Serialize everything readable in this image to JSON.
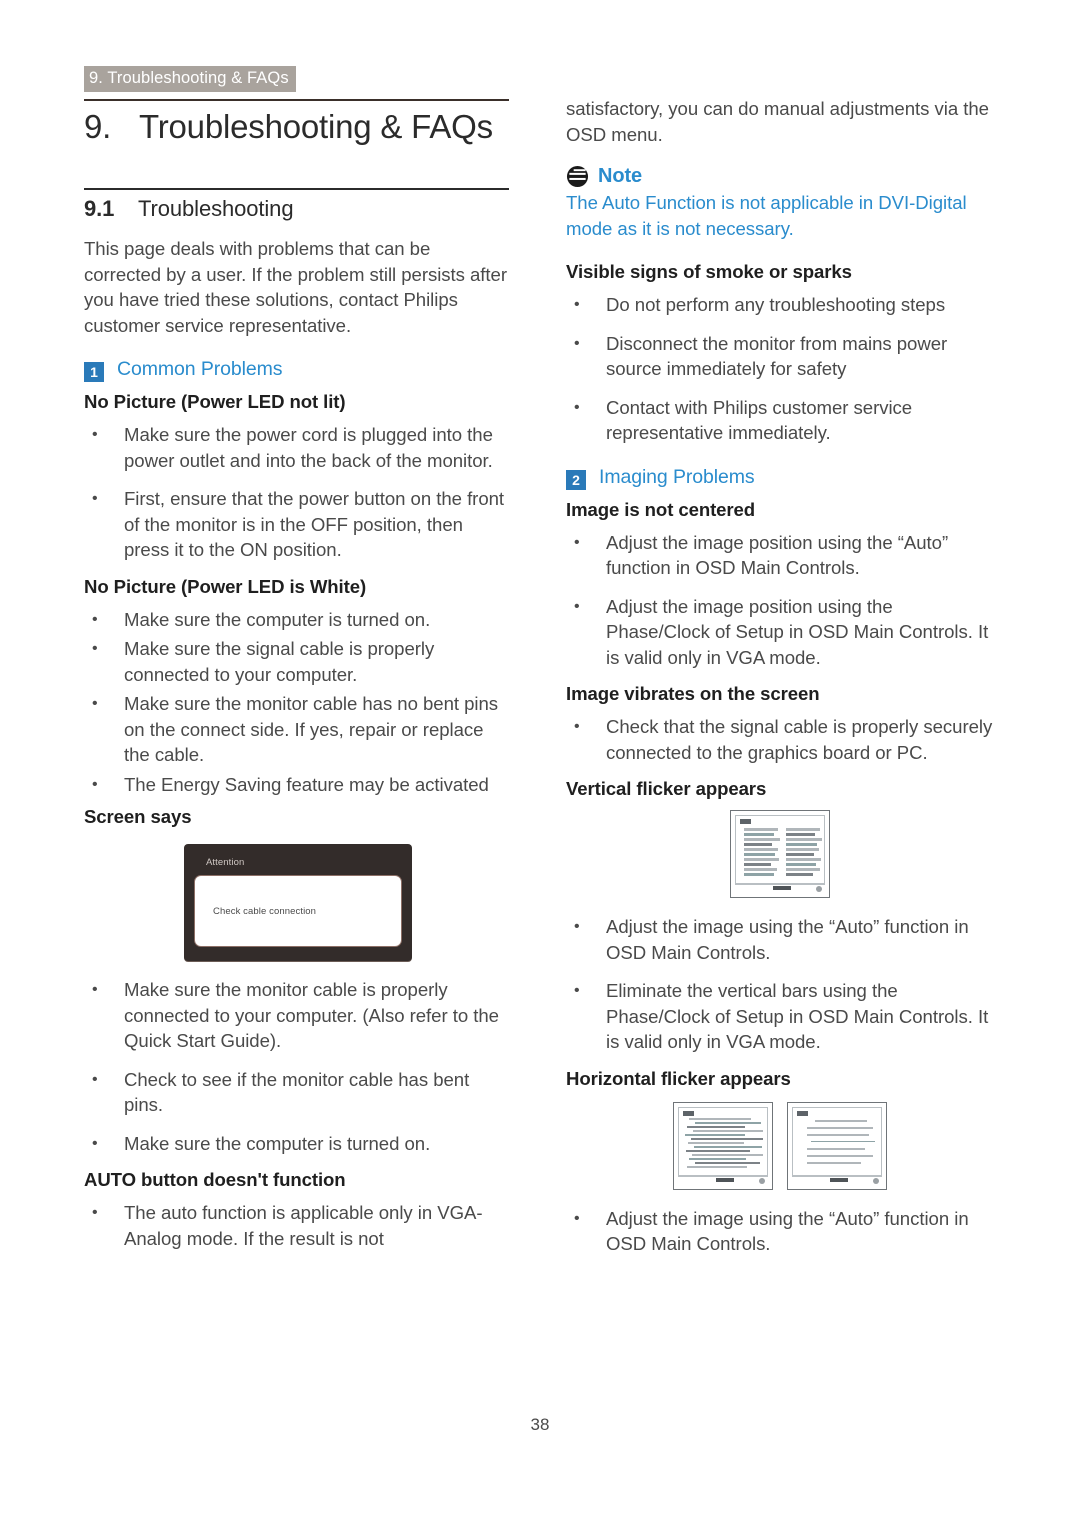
{
  "header": {
    "breadcrumb": "9. Troubleshooting & FAQs",
    "chapter_number": "9.",
    "chapter_title": "Troubleshooting & FAQs"
  },
  "colors": {
    "accent_blue": "#2a8ccd",
    "badge_blue": "#2a7ab9",
    "breadcrumb_gray": "#a9a39d",
    "rule_dark": "#3a2f2a",
    "dialog_dark": "#332c2a"
  },
  "section": {
    "number": "9.1",
    "title": "Troubleshooting",
    "intro": "This page deals with problems that can be corrected by a user. If the problem still persists after you have tried these solutions, contact Philips customer service representative."
  },
  "group1": {
    "badge": "1",
    "label": "Common Problems"
  },
  "group2": {
    "badge": "2",
    "label": "Imaging Problems"
  },
  "left": {
    "h_no_picture_led_not_lit": "No Picture (Power LED not lit)",
    "bullets_led_not_lit": [
      "Make sure the power cord is plugged into the power outlet and into the back of the monitor.",
      "First, ensure that the power button on the front of the monitor is in the OFF position, then press it to the ON position."
    ],
    "h_no_picture_led_white": "No Picture (Power LED is White)",
    "bullets_led_white": [
      "Make sure the computer is turned on.",
      "Make sure the signal cable is properly connected to your computer.",
      "Make sure the monitor cable has no bent pins on the connect side. If yes, repair or replace the cable.",
      "The Energy Saving feature may be activated"
    ],
    "h_screen_says": "Screen says",
    "attention_dialog": {
      "title": "Attention",
      "message": "Check cable connection"
    },
    "bullets_screen_says": [
      "Make sure the monitor cable is properly connected to your computer. (Also refer to the Quick Start Guide).",
      "Check to see if the monitor cable has bent pins.",
      "Make sure the computer is turned on."
    ],
    "h_auto_button": "AUTO button doesn't function",
    "bullets_auto_button": [
      "The auto function is applicable only in VGA-Analog mode.  If the result is not"
    ]
  },
  "right": {
    "continuation": "satisfactory, you can do manual adjustments via the OSD menu.",
    "note": {
      "icon": "note-icon",
      "label": "Note",
      "text": "The Auto Function is not applicable in DVI-Digital mode as it is not necessary."
    },
    "h_smoke_sparks": "Visible signs of smoke or sparks",
    "bullets_smoke_sparks": [
      "Do not perform any troubleshooting steps",
      "Disconnect the monitor from mains power source immediately for safety",
      "Contact with Philips customer service representative immediately."
    ],
    "h_not_centered": "Image is not centered",
    "bullets_not_centered": [
      "Adjust the image position using the “Auto” function in OSD Main Controls.",
      "Adjust the image position using the Phase/Clock of Setup in OSD Main Controls.  It is valid only in VGA mode."
    ],
    "h_vibrates": "Image vibrates on the screen",
    "bullets_vibrates": [
      "Check that the signal cable is properly securely connected to the graphics board or PC."
    ],
    "h_vertical_flicker": "Vertical flicker appears",
    "bullets_vertical_flicker": [
      "Adjust the image using the “Auto” function in OSD Main Controls.",
      "Eliminate the vertical bars using the Phase/Clock of Setup in OSD Main Controls. It is valid only in VGA mode."
    ],
    "h_horizontal_flicker": "Horizontal flicker appears",
    "bullets_horizontal_flicker": [
      "Adjust the image using the “Auto” function in OSD Main Controls."
    ]
  },
  "footer": {
    "page_number": "38"
  }
}
